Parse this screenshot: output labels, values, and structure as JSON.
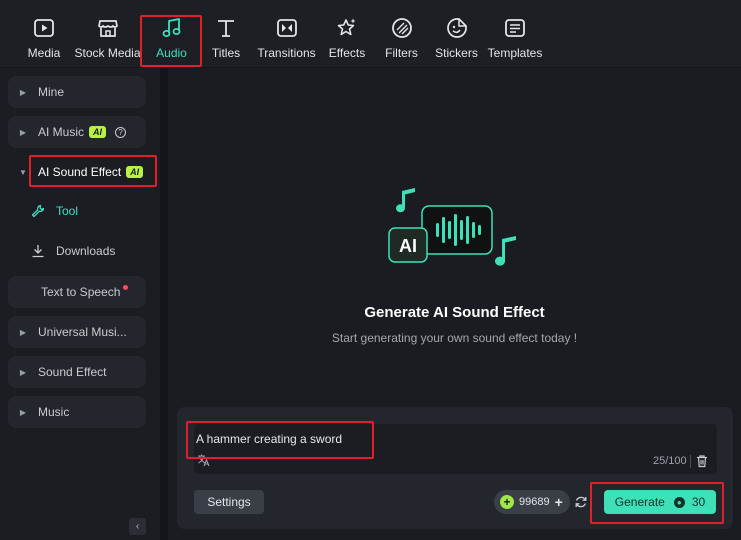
{
  "toolbar": {
    "tabs": [
      {
        "label": "Media",
        "icon": "media-icon"
      },
      {
        "label": "Stock Media",
        "icon": "store-icon"
      },
      {
        "label": "Audio",
        "icon": "music-note-icon",
        "active": true
      },
      {
        "label": "Titles",
        "icon": "text-icon"
      },
      {
        "label": "Transitions",
        "icon": "transition-icon"
      },
      {
        "label": "Effects",
        "icon": "sparkle-star-icon"
      },
      {
        "label": "Filters",
        "icon": "filter-icon"
      },
      {
        "label": "Stickers",
        "icon": "sticker-icon"
      },
      {
        "label": "Templates",
        "icon": "template-icon"
      }
    ]
  },
  "sidebar": {
    "items": [
      {
        "label": "Mine"
      },
      {
        "label": "AI Music",
        "badge": "AI",
        "help": "?"
      },
      {
        "label": "AI Sound Effect",
        "badge": "AI",
        "expanded": true
      },
      {
        "label": "Text to Speech",
        "dot": true
      },
      {
        "label": "Universal Musi..."
      },
      {
        "label": "Sound Effect"
      },
      {
        "label": "Music"
      }
    ],
    "subitems": [
      {
        "label": "Tool",
        "icon": "wrench-icon",
        "active": true
      },
      {
        "label": "Downloads",
        "icon": "download-icon"
      }
    ],
    "collapse_glyph": "‹"
  },
  "main": {
    "art_label": "AI",
    "title": "Generate AI Sound Effect",
    "subtitle": "Start generating your own sound effect today !",
    "prompt": {
      "value": "A hammer creating a sword",
      "count": "25/100"
    },
    "settings_label": "Settings",
    "credits": "99689",
    "generate": {
      "label": "Generate",
      "cost": "30"
    }
  },
  "colors": {
    "accent": "#3fe0c2",
    "ai_badge": "#b9f243",
    "highlight_box": "#e0212b",
    "generate_bg": "#3ee0b7"
  }
}
